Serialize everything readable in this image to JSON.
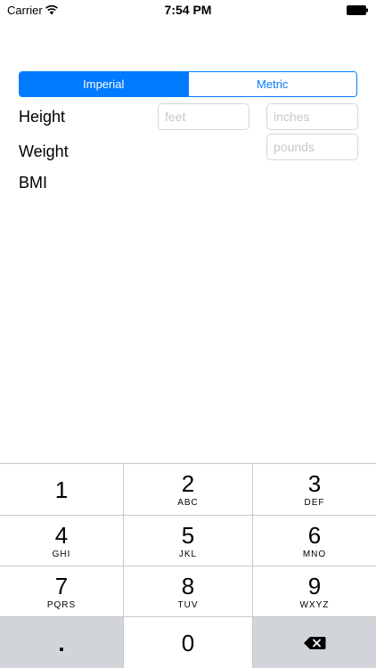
{
  "status": {
    "carrier": "Carrier",
    "time": "7:54 PM"
  },
  "units": {
    "options": [
      "Imperial",
      "Metric"
    ],
    "selected": "Imperial"
  },
  "form": {
    "height_label": "Height",
    "weight_label": "Weight",
    "bmi_label": "BMI",
    "feet_placeholder": "feet",
    "inches_placeholder": "inches",
    "pounds_placeholder": "pounds",
    "feet_value": "",
    "inches_value": "",
    "pounds_value": ""
  },
  "keypad": {
    "keys": [
      {
        "digit": "1",
        "letters": ""
      },
      {
        "digit": "2",
        "letters": "ABC"
      },
      {
        "digit": "3",
        "letters": "DEF"
      },
      {
        "digit": "4",
        "letters": "GHI"
      },
      {
        "digit": "5",
        "letters": "JKL"
      },
      {
        "digit": "6",
        "letters": "MNO"
      },
      {
        "digit": "7",
        "letters": "PQRS"
      },
      {
        "digit": "8",
        "letters": "TUV"
      },
      {
        "digit": "9",
        "letters": "WXYZ"
      }
    ],
    "decimal": ".",
    "zero": "0",
    "delete_icon": "backspace-icon"
  },
  "colors": {
    "accent": "#007aff",
    "keyboard_gray": "#d1d4d9",
    "placeholder": "#c7c7cd"
  }
}
